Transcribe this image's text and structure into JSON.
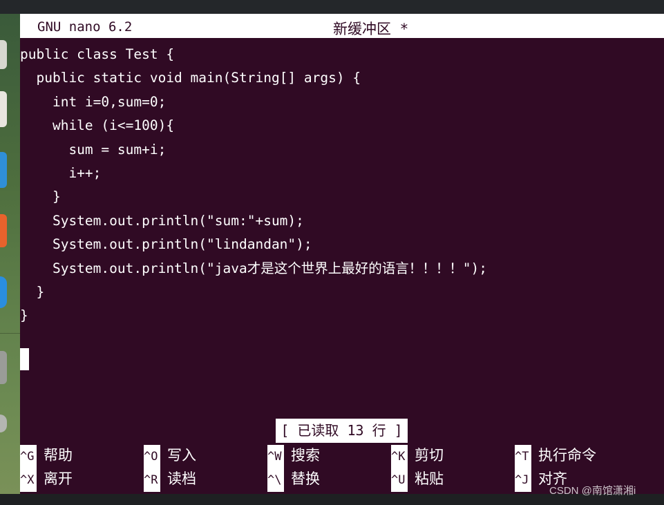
{
  "titlebar": {
    "version": "GNU nano 6.2",
    "filename": "新缓冲区 *"
  },
  "code_lines": [
    "public class Test {",
    "  public static void main(String[] args) {",
    "    int i=0,sum=0;",
    "    while (i<=100){",
    "      sum = sum+i;",
    "      i++;",
    "    }",
    "    System.out.println(\"sum:\"+sum);",
    "    System.out.println(\"lindandan\");",
    "    System.out.println(\"java才是这个世界上最好的语言！！！！\");",
    "  }",
    "}"
  ],
  "status": "[ 已读取 13 行 ]",
  "shortcuts": [
    {
      "key": "^G",
      "label": "帮助"
    },
    {
      "key": "^O",
      "label": "写入"
    },
    {
      "key": "^W",
      "label": "搜索"
    },
    {
      "key": "^K",
      "label": "剪切"
    },
    {
      "key": "^T",
      "label": "执行命令"
    },
    {
      "key": "^X",
      "label": "离开"
    },
    {
      "key": "^R",
      "label": "读档"
    },
    {
      "key": "^\\",
      "label": "替换"
    },
    {
      "key": "^U",
      "label": "粘贴"
    },
    {
      "key": "^J",
      "label": "对齐"
    }
  ],
  "watermark": "CSDN @南馆潇湘i",
  "colors": {
    "terminal_background": "#300a24",
    "foreground": "#ffffff"
  }
}
